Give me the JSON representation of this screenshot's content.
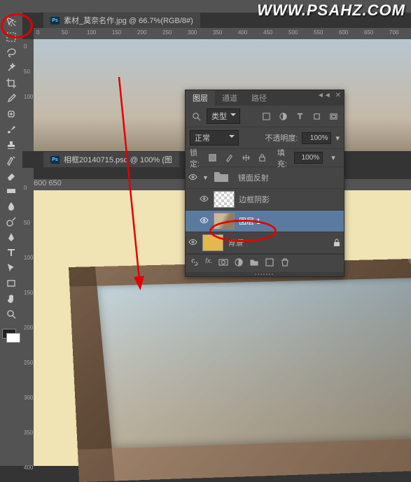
{
  "watermark": "WWW.PSAHZ.COM",
  "tabs": {
    "doc1": "素材_莫奈名作.jpg @ 66.7%(RGB/8#)",
    "doc2": "相框20140715.psd @ 100% (图"
  },
  "ruler_top": [
    "0",
    "50",
    "100",
    "150",
    "200",
    "250",
    "300",
    "350",
    "400",
    "450",
    "500",
    "550",
    "600",
    "650",
    "700"
  ],
  "ruler_left1": [
    "0",
    "50",
    "100"
  ],
  "ruler_top2": [
    "",
    "",
    "",
    "600",
    "650"
  ],
  "ruler_left2": [
    "0",
    "50",
    "100",
    "150",
    "200",
    "250",
    "300",
    "350",
    "400"
  ],
  "layers_panel": {
    "tabs": {
      "layers": "图层",
      "channels": "通道",
      "paths": "路径"
    },
    "filter_label": "类型",
    "blend_mode": "正常",
    "opacity_label": "不透明度:",
    "opacity_value": "100%",
    "lock_label": "锁定:",
    "fill_label": "填充:",
    "fill_value": "100%",
    "items": [
      {
        "name": "镜面反射",
        "type": "group"
      },
      {
        "name": "边框阴影",
        "type": "checker"
      },
      {
        "name": "图层 1",
        "type": "paint",
        "selected": true
      },
      {
        "name": "背景",
        "type": "yellow",
        "locked": true,
        "italic": true
      }
    ]
  },
  "tool_names": [
    "move",
    "marquee",
    "lasso",
    "wand",
    "crop",
    "eyedropper",
    "heal",
    "brush",
    "stamp",
    "history",
    "eraser",
    "gradient",
    "blur",
    "dodge",
    "pen",
    "type",
    "path-select",
    "rectangle",
    "hand",
    "zoom"
  ]
}
